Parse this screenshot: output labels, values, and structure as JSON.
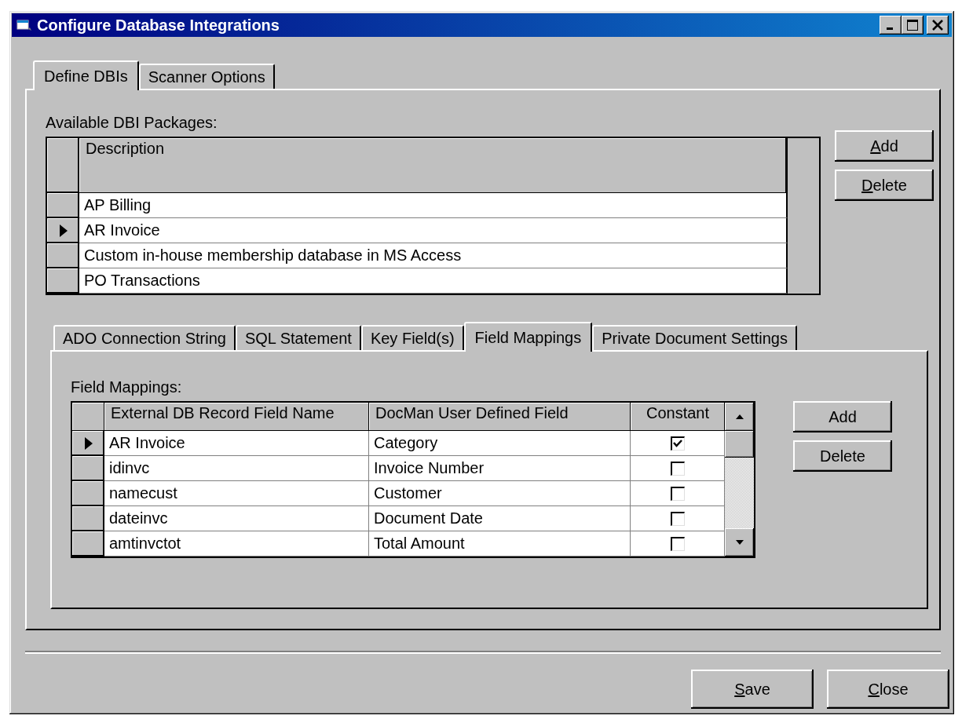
{
  "window": {
    "title": "Configure Database Integrations"
  },
  "tabs": [
    {
      "label": "Define DBIs",
      "selected": true
    },
    {
      "label": "Scanner Options",
      "selected": false
    }
  ],
  "packages": {
    "label": "Available DBI Packages:",
    "columns": [
      "Description"
    ],
    "rows": [
      {
        "description": "AP Billing",
        "current": false
      },
      {
        "description": "AR Invoice",
        "current": true
      },
      {
        "description": "Custom in-house membership database in MS Access",
        "current": false
      },
      {
        "description": "PO Transactions",
        "current": false
      }
    ],
    "buttons": [
      {
        "label": "Add",
        "mnemonic": true
      },
      {
        "label": "Delete",
        "mnemonic": true
      }
    ]
  },
  "inner_tabs": [
    {
      "label": "ADO Connection String",
      "selected": false
    },
    {
      "label": "SQL Statement",
      "selected": false
    },
    {
      "label": "Key Field(s)",
      "selected": false
    },
    {
      "label": "Field Mappings",
      "selected": true
    },
    {
      "label": "Private Document Settings",
      "selected": false
    }
  ],
  "field_mappings": {
    "label": "Field Mappings:",
    "columns": [
      "External DB Record Field Name",
      "DocMan User Defined Field",
      "Constant"
    ],
    "rows": [
      {
        "external": "AR Invoice",
        "docman": "Category",
        "constant": true,
        "current": true
      },
      {
        "external": "idinvc",
        "docman": "Invoice Number",
        "constant": false,
        "current": false
      },
      {
        "external": "namecust",
        "docman": "Customer",
        "constant": false,
        "current": false
      },
      {
        "external": "dateinvc",
        "docman": "Document Date",
        "constant": false,
        "current": false
      },
      {
        "external": "amtinvctot",
        "docman": "Total Amount",
        "constant": false,
        "current": false
      }
    ],
    "buttons": [
      {
        "label": "Add",
        "mnemonic": false
      },
      {
        "label": "Delete",
        "mnemonic": false
      }
    ]
  },
  "footer_buttons": [
    {
      "label": "Save",
      "mnemonic": true
    },
    {
      "label": "Close",
      "mnemonic": true
    }
  ]
}
